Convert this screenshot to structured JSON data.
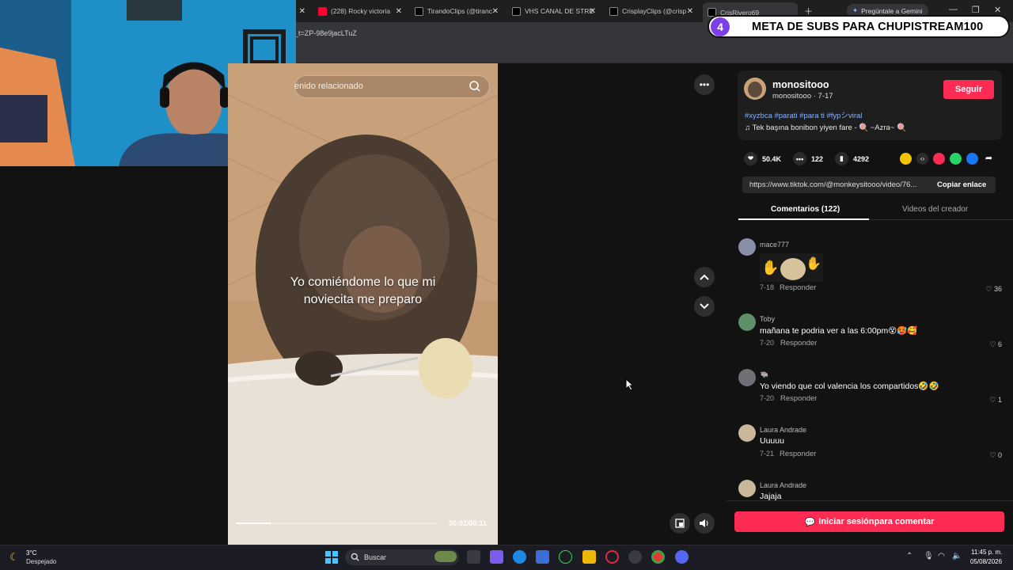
{
  "browser": {
    "tabs": [
      {
        "label": "(228) Rocky victoria",
        "color": "#ff0033"
      },
      {
        "label": "TirandoClips (@tiranc",
        "color": "#111111"
      },
      {
        "label": "VHS CANAL DE STRE",
        "color": "#111111"
      },
      {
        "label": "CrisplayClips (@crisp",
        "color": "#111111"
      },
      {
        "label": "CrisRivero69",
        "color": "#111111"
      }
    ],
    "gemini_label": "Pregúntale a Gemini",
    "url_text": "_t=ZP-98e9jacLTuZ"
  },
  "overlay": {
    "meta_number": "4",
    "meta_text": "META DE SUBS PARA CHUPISTREAM100"
  },
  "video": {
    "search_placeholder": "enido relacionado",
    "caption_line1": "Yo comiéndome lo que mi",
    "caption_line2": "noviecita me preparo",
    "time": "00:01/00:11",
    "progress": 0.17
  },
  "creator": {
    "username": "monositooo",
    "meta": "monositooo · 7-17",
    "follow_label": "Seguir",
    "hashtags": "#xyzbca #parati #para ti #fypシviral",
    "music": "Tek başına bonibon yiyen fare - 🍭 ~Azra~ 🍭"
  },
  "stats": {
    "likes": "50.4K",
    "comments": "122",
    "saves": "4292"
  },
  "link": {
    "url": "https://www.tiktok.com/@monkeysitooo/video/76...",
    "copy_label": "Copiar enlace"
  },
  "tabs": {
    "comments": "Comentarios (122)",
    "creator_videos": "Videos del creador"
  },
  "comments": [
    {
      "user": "mace777",
      "text": "",
      "date": "7-18",
      "reply": "Responder",
      "likes": "36"
    },
    {
      "user": "Toby",
      "text": "mañana te podria ver a las 6:00pm😵🥵🥰",
      "date": "7-20",
      "reply": "Responder",
      "likes": "6"
    },
    {
      "user": "🐃",
      "text": "Yo viendo que col valencia los compartidos🤣🤣",
      "date": "7-20",
      "reply": "Responder",
      "likes": "1"
    },
    {
      "user": "Laura Andrade",
      "text": "Uuuuu",
      "date": "7-21",
      "reply": "Responder",
      "likes": "0"
    },
    {
      "user": "Laura Andrade",
      "text": "Jajaja",
      "date": "",
      "reply": "",
      "likes": ""
    }
  ],
  "login_label": "Iniciar sesiónpara comentar",
  "taskbar": {
    "temp": "3°C",
    "weather": "Despejado",
    "search": "Buscar",
    "time": "11:45 p. m.",
    "date": "05/08/2026"
  },
  "colors": {
    "accent": "#fe2c55",
    "hashtag": "#8ab4ff",
    "meta_badge": "#7b3fe4"
  }
}
